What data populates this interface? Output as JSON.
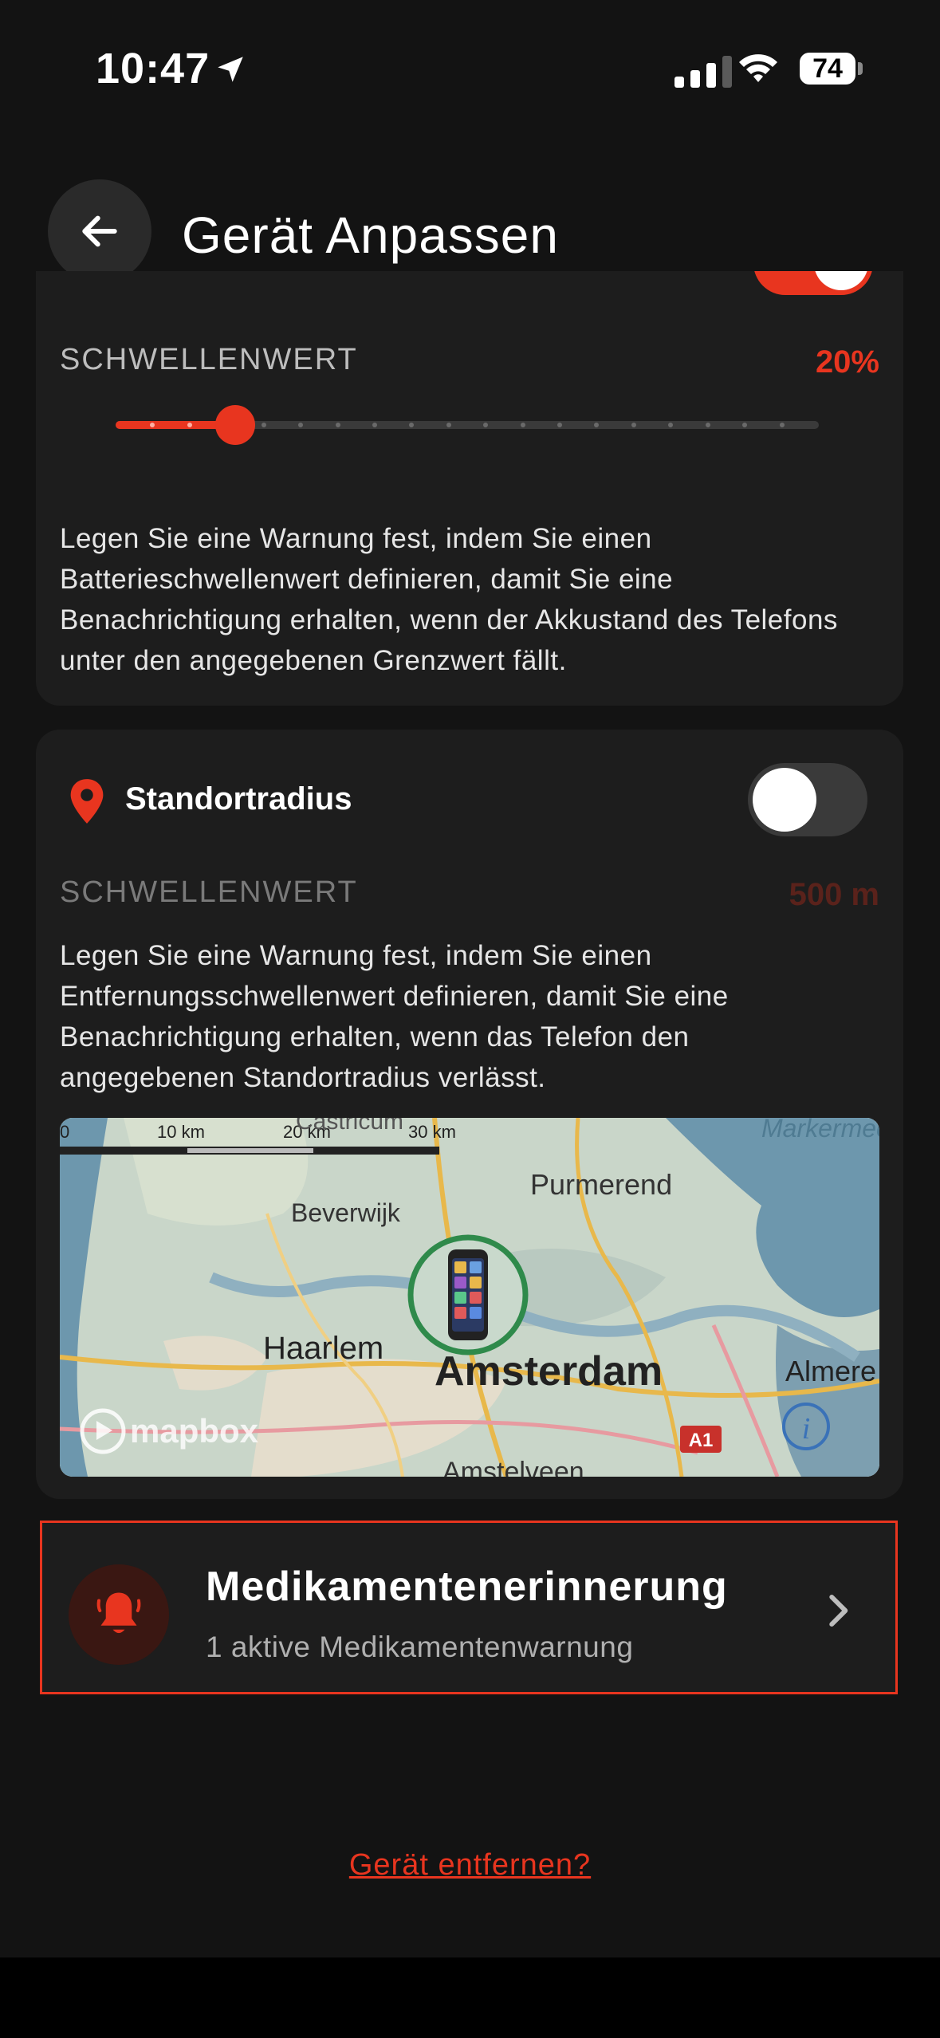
{
  "status_bar": {
    "time": "10:47",
    "battery": "74"
  },
  "header": {
    "title": "Gerät Anpassen"
  },
  "battery_card": {
    "threshold_label": "SCHWELLENWERT",
    "threshold_value": "20%",
    "slider_fraction": 0.17,
    "description": "Legen Sie eine Warnung fest, indem Sie einen Batterieschwellenwert definieren, damit Sie eine Benachrichtigung erhalten, wenn der Akkustand des Telefons unter den angegebenen Grenzwert fällt."
  },
  "location_card": {
    "title": "Standortradius",
    "threshold_label": "SCHWELLENWERT",
    "threshold_value": "500 m",
    "description": "Legen Sie eine Warnung fest, indem Sie einen Entfernungsschwellenwert definieren, damit Sie eine Benachrichtigung erhalten, wenn das Telefon den angegebenen Standortradius verlässt.",
    "map": {
      "scale_labels": [
        "0",
        "10 km",
        "20 km",
        "30 km"
      ],
      "places": [
        "Castricum",
        "Purmerend",
        "Beverwijk",
        "Haarlem",
        "Amsterdam",
        "Almere",
        "Amstelveen",
        "Markermeer"
      ],
      "road_label": "A1",
      "attribution": "mapbox"
    }
  },
  "medication": {
    "title": "Medikamentenerinnerung",
    "subtitle": "1 aktive Medikamentenwarnung"
  },
  "remove_link": "Gerät entfernen?",
  "colors": {
    "accent": "#e8351f",
    "card": "#1d1d1d",
    "background": "#131313"
  }
}
